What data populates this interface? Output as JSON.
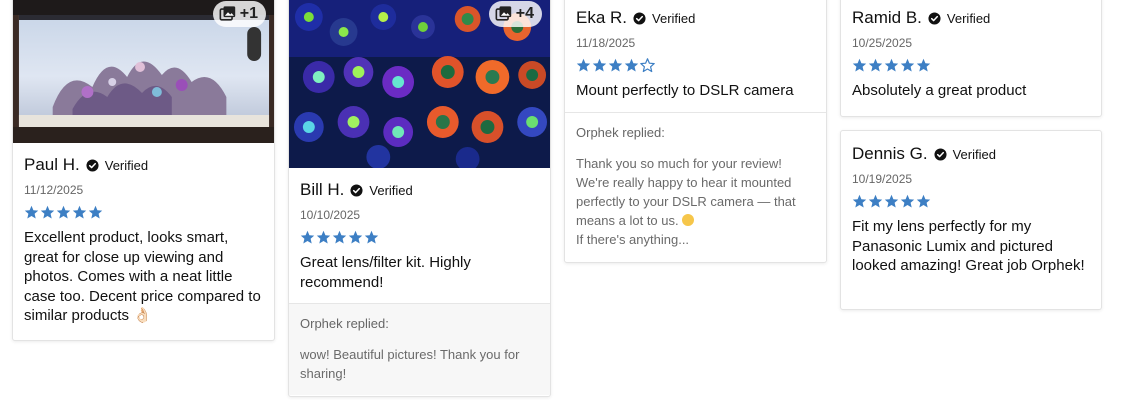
{
  "colors": {
    "star": "#3d7fc4",
    "text": "#111111",
    "muted": "#666666",
    "reply_bg": "#f7f7f7"
  },
  "icons": {
    "verified": "verified-check-icon",
    "photos": "photo-gallery-icon",
    "star": "star-icon"
  },
  "reviews": [
    {
      "photo_count": "+1",
      "name": "Paul H.",
      "verified": "Verified",
      "date": "11/12/2025",
      "rating": 5,
      "text": "Excellent product, looks smart, great for close up viewing and photos. Comes with a neat little case too. Decent price compared to similar products 👌🏻"
    },
    {
      "photo_count": "+4",
      "name": "Bill H.",
      "verified": "Verified",
      "date": "10/10/2025",
      "rating": 5,
      "text": "Great lens/filter kit. Highly recommend!",
      "reply_label": "Orphek replied:",
      "reply_text": "wow! Beautiful pictures! Thank you for sharing!"
    },
    {
      "name": "Eka R.",
      "verified": "Verified",
      "date": "11/18/2025",
      "rating": 4,
      "text": "Mount perfectly to DSLR camera",
      "reply_label": "Orphek replied:",
      "reply_text_1": "Thank you so much for your review! We're really happy to hear it mounted perfectly to your DSLR camera — that means a lot to us.",
      "reply_text_2": "If there's anything..."
    },
    {
      "name": "Ramid B.",
      "verified": "Verified",
      "date": "10/25/2025",
      "rating": 5,
      "text": "Absolutely a great product"
    },
    {
      "name": "Dennis G.",
      "verified": "Verified",
      "date": "10/19/2025",
      "rating": 5,
      "text": "Fit my lens perfectly for my Panasonic Lumix and pictured looked amazing! Great job Orphek!"
    }
  ]
}
